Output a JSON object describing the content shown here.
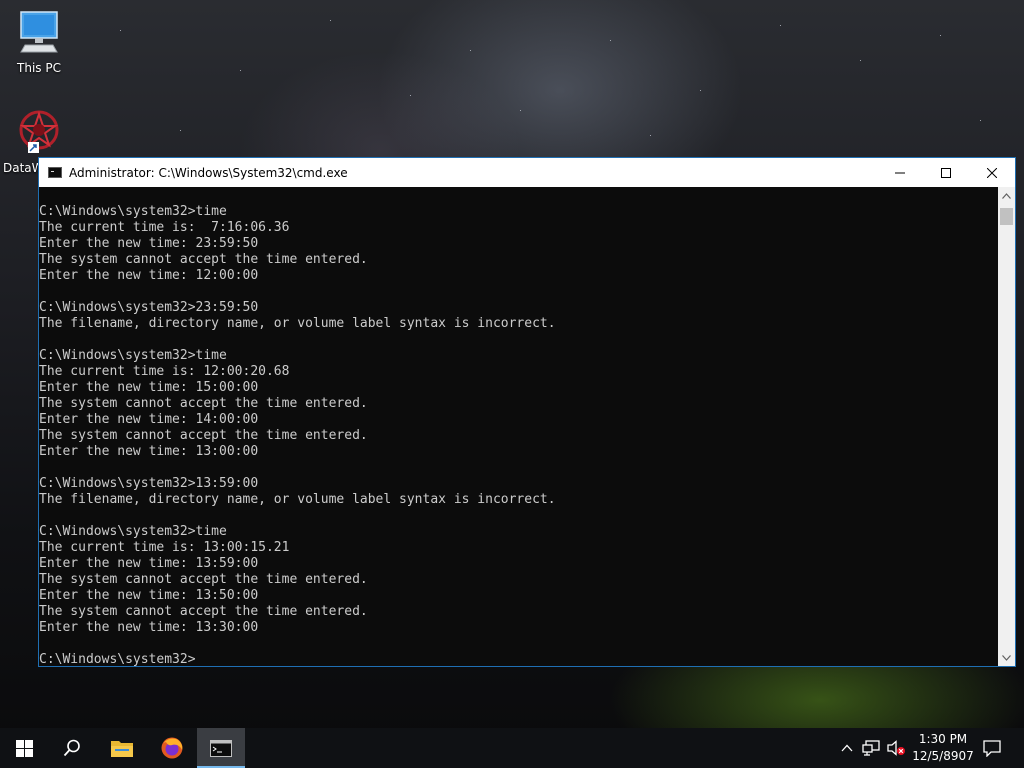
{
  "desktop": {
    "icons": [
      {
        "label": "This PC"
      },
      {
        "label": "DataW"
      }
    ]
  },
  "window": {
    "title": "Administrator: C:\\Windows\\System32\\cmd.exe",
    "console_lines": [
      "C:\\Windows\\system32>time",
      "The current time is:  7:16:06.36",
      "Enter the new time: 23:59:50",
      "The system cannot accept the time entered.",
      "Enter the new time: 12:00:00",
      "",
      "C:\\Windows\\system32>23:59:50",
      "The filename, directory name, or volume label syntax is incorrect.",
      "",
      "C:\\Windows\\system32>time",
      "The current time is: 12:00:20.68",
      "Enter the new time: 15:00:00",
      "The system cannot accept the time entered.",
      "Enter the new time: 14:00:00",
      "The system cannot accept the time entered.",
      "Enter the new time: 13:00:00",
      "",
      "C:\\Windows\\system32>13:59:00",
      "The filename, directory name, or volume label syntax is incorrect.",
      "",
      "C:\\Windows\\system32>time",
      "The current time is: 13:00:15.21",
      "Enter the new time: 13:59:00",
      "The system cannot accept the time entered.",
      "Enter the new time: 13:50:00",
      "The system cannot accept the time entered.",
      "Enter the new time: 13:30:00",
      "",
      "C:\\Windows\\system32>"
    ]
  },
  "taskbar": {
    "pinned": [
      {
        "icon": "windows-start-icon"
      },
      {
        "icon": "search-icon"
      },
      {
        "icon": "file-explorer-icon"
      },
      {
        "icon": "firefox-icon"
      },
      {
        "icon": "cmd-icon",
        "active": true
      }
    ],
    "tray_icons": [
      "chevron-up-icon",
      "network-icon",
      "volume-muted-icon"
    ],
    "clock": {
      "time": "1:30 PM",
      "date": "12/5/8907"
    },
    "notification_icon": "notification-icon"
  },
  "colors": {
    "console_bg": "#0c0c0c",
    "console_text": "#cccccc",
    "accent": "#76b9ed",
    "window_border": "#1f6fb3"
  }
}
